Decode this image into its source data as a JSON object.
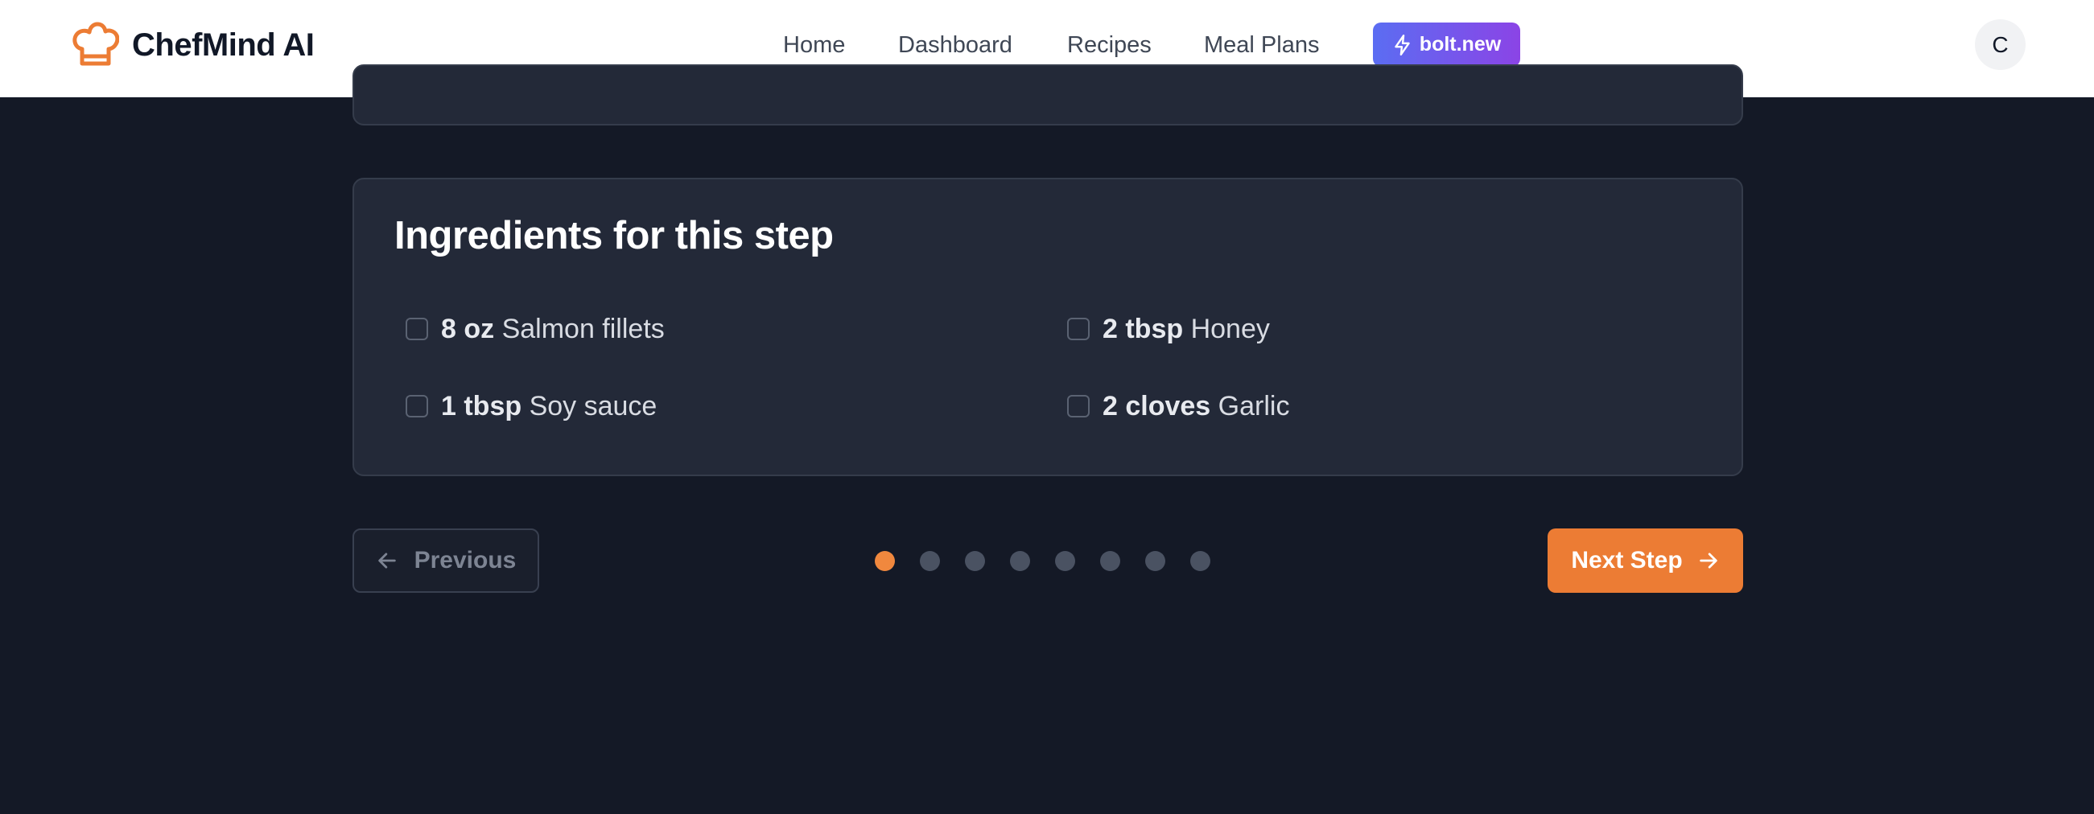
{
  "header": {
    "brand": "ChefMind AI",
    "nav": [
      "Home",
      "Dashboard",
      "Recipes",
      "Meal Plans"
    ],
    "bolt_label": "bolt.new",
    "avatar_initial": "C"
  },
  "ingredients": {
    "title": "Ingredients for this step",
    "items": [
      {
        "qty": "8 oz",
        "name": "Salmon fillets",
        "checked": false
      },
      {
        "qty": "2 tbsp",
        "name": "Honey",
        "checked": false
      },
      {
        "qty": "1 tbsp",
        "name": "Soy sauce",
        "checked": false
      },
      {
        "qty": "2 cloves",
        "name": "Garlic",
        "checked": false
      }
    ]
  },
  "pagination": {
    "previous_label": "Previous",
    "next_label": "Next Step",
    "total_steps": 8,
    "current_step": 1
  },
  "colors": {
    "accent": "#ec7c34",
    "background": "#141926",
    "card": "#232938"
  }
}
